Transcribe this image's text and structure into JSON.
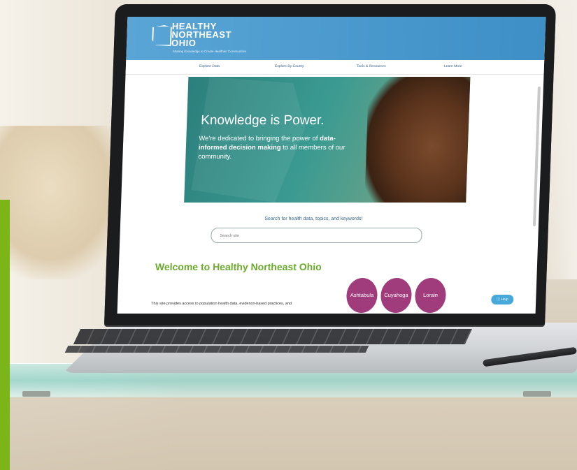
{
  "site": {
    "logo_line1": "HEALTHY",
    "logo_line2": "NORTHEAST",
    "logo_line3": "OHIO",
    "tagline": "Sharing Knowledge to Create Healthier Communities"
  },
  "nav": {
    "items": [
      "Explore Data",
      "Explore By County",
      "Tools & Resources",
      "Learn More"
    ]
  },
  "hero": {
    "title": "Knowledge is Power.",
    "sub_part1": "We're dedicated to bringing the power of",
    "sub_bold": "data-informed decision making",
    "sub_part2": "to all members of our community."
  },
  "search": {
    "label": "Search for health data, topics, and keywords!",
    "placeholder": "Search site"
  },
  "welcome": {
    "heading": "Welcome to Healthy Northeast Ohio",
    "intro": "This site provides access to population health data, evidence-based practices, and"
  },
  "counties": [
    "Ashtabula",
    "Cuyahoga",
    "Lorain"
  ],
  "help": {
    "label": "Help",
    "icon": "help-circle-icon"
  },
  "colors": {
    "brand_green": "#7cb518",
    "header_blue": "#3d8fc6",
    "heading_green": "#6aab2a",
    "county_purple": "#a03c7c",
    "help_blue": "#47a9d9"
  }
}
